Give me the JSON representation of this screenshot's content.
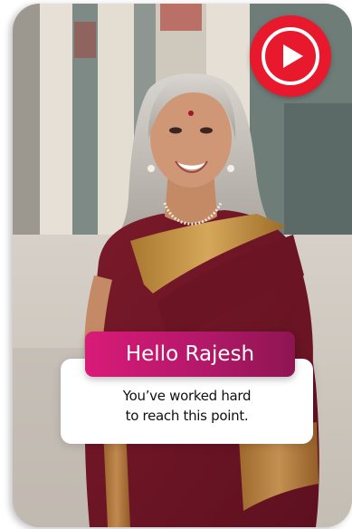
{
  "video": {
    "play_button_icon": "youtube-play-icon",
    "accent_color": "#e8192c"
  },
  "greeting": {
    "title": "Hello Rajesh",
    "color": "#c21873"
  },
  "message": {
    "line1": "You’ve worked hard",
    "line2": "to reach this point."
  }
}
